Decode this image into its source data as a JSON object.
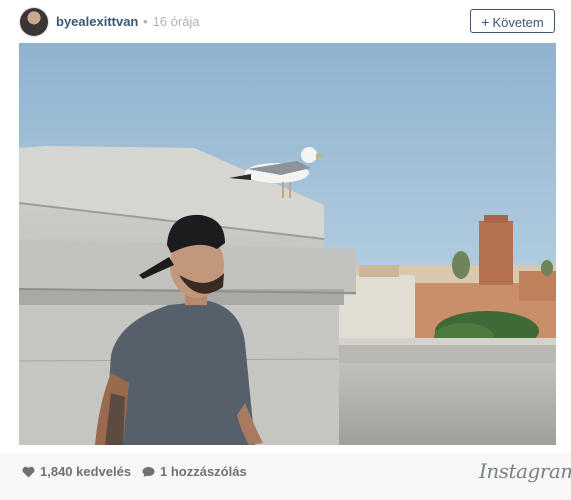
{
  "post": {
    "username": "byealexittvan",
    "separator": "•",
    "time": "16 órája",
    "follow_label": "Követem",
    "follow_icon": "plus-icon"
  },
  "footer": {
    "likes": "1,840 kedvelés",
    "comments": "1 hozzászólás",
    "brand": "Instagram",
    "like_icon": "heart-icon",
    "comment_icon": "speech-bubble-icon"
  },
  "colors": {
    "accent": "#3d5875",
    "muted": "#aeb3b9",
    "footer_bg": "#f7f7f7",
    "footer_text": "#6e7276"
  }
}
